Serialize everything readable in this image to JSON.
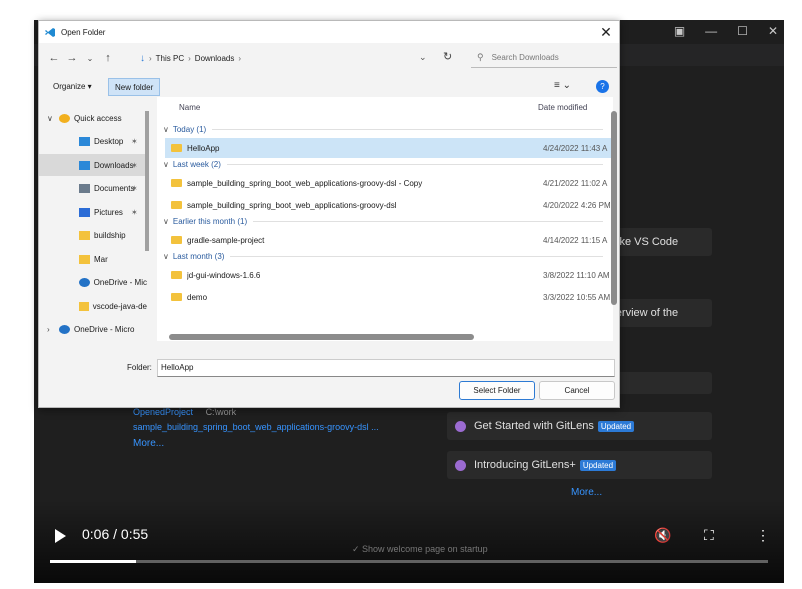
{
  "vscode": {
    "cards": [
      {
        "text": "o make VS Code"
      },
      {
        "text": "n overview of the"
      }
    ],
    "gitlens_cards": [
      {
        "text": "Get Started with GitLens",
        "badge": "Updated"
      },
      {
        "text": "Introducing GitLens+",
        "badge": "Updated"
      }
    ],
    "recent": [
      {
        "name": "OpenedProject",
        "path": "C:\\work"
      },
      {
        "name": "sample_building_spring_boot_web_applications-groovy-dsl ..."
      }
    ],
    "recent_more": "More...",
    "walkthrough_more": "More...",
    "show_welcome": "Show welcome page on startup"
  },
  "video": {
    "time": "0:06 / 0:55",
    "progress": 0.12
  },
  "dialog": {
    "title": "Open Folder",
    "breadcrumb": [
      "This PC",
      "Downloads"
    ],
    "search_placeholder": "Search Downloads",
    "toolbar": {
      "organize": "Organize ▾",
      "new_folder": "New folder"
    },
    "nav": [
      {
        "label": "Quick access",
        "icon": "star-icon",
        "pinned": false
      },
      {
        "label": "Desktop",
        "icon": "desktop-icon",
        "pinned": true
      },
      {
        "label": "Downloads",
        "icon": "download-icon",
        "pinned": true,
        "selected": true
      },
      {
        "label": "Documents",
        "icon": "document-icon",
        "pinned": true
      },
      {
        "label": "Pictures",
        "icon": "pictures-icon",
        "pinned": true
      },
      {
        "label": "buildship",
        "icon": "folder-icon",
        "pinned": false
      },
      {
        "label": "Mar",
        "icon": "folder-icon",
        "pinned": false
      },
      {
        "label": "OneDrive - Mic",
        "icon": "cloud-icon",
        "pinned": false
      },
      {
        "label": "vscode-java-de",
        "icon": "folder-icon",
        "pinned": false
      },
      {
        "label": "OneDrive - Micro",
        "icon": "cloud-icon",
        "pinned": false
      }
    ],
    "columns": {
      "name": "Name",
      "date": "Date modified"
    },
    "groups": [
      {
        "label": "Today (1)",
        "files": [
          {
            "name": "HelloApp",
            "date": "4/24/2022 11:43 A",
            "selected": true
          }
        ]
      },
      {
        "label": "Last week (2)",
        "files": [
          {
            "name": "sample_building_spring_boot_web_applications-groovy-dsl - Copy",
            "date": "4/21/2022 11:02 A"
          },
          {
            "name": "sample_building_spring_boot_web_applications-groovy-dsl",
            "date": "4/20/2022 4:26 PM"
          }
        ]
      },
      {
        "label": "Earlier this month (1)",
        "files": [
          {
            "name": "gradle-sample-project",
            "date": "4/14/2022 11:15 A"
          }
        ]
      },
      {
        "label": "Last month (3)",
        "files": [
          {
            "name": "jd-gui-windows-1.6.6",
            "date": "3/8/2022 11:10 AM"
          },
          {
            "name": "demo",
            "date": "3/3/2022 10:55 AM"
          }
        ]
      }
    ],
    "folder_label": "Folder:",
    "folder_value": "HelloApp",
    "select_label": "Select Folder",
    "cancel_label": "Cancel"
  }
}
